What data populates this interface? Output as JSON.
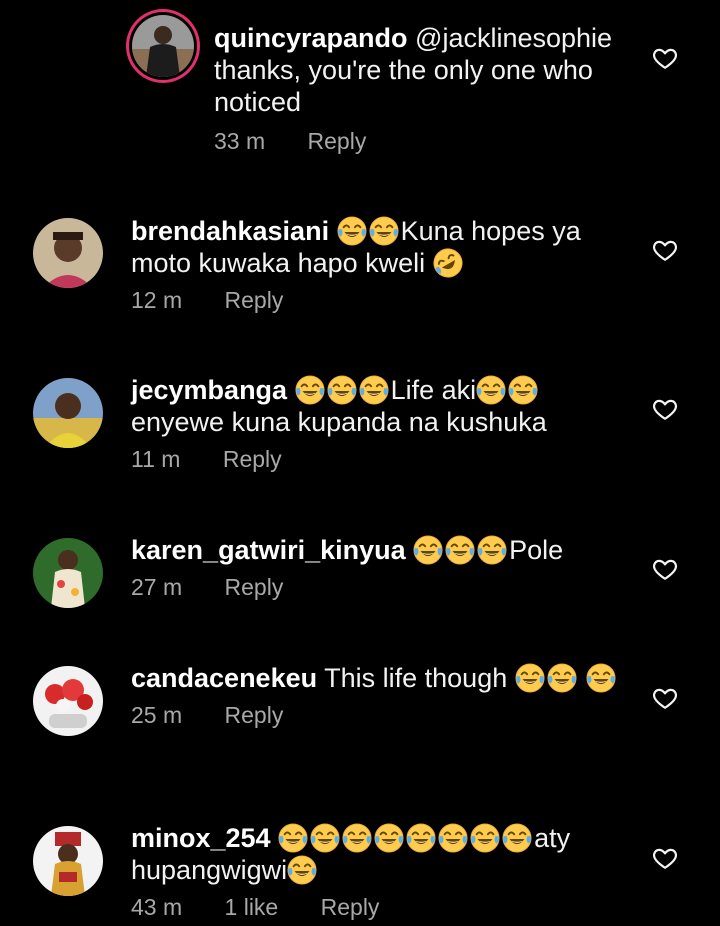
{
  "comments": [
    {
      "username": "quincyrapando",
      "text": "@jacklinesophie thanks, you're the only one who noticed",
      "time": "33 m",
      "reply": "Reply",
      "likes": ""
    },
    {
      "username": "brendahkasiani",
      "text_after_emoji": "Kuna hopes ya moto kuwaka hapo kweli",
      "time": "12 m",
      "reply": "Reply",
      "emoji": [
        "joy",
        "joy",
        "rofl"
      ]
    },
    {
      "username": "jecymbanga",
      "text_part1": "Life aki",
      "text_part2": "enyewe kuna kupanda na kushuka",
      "time": "11 m",
      "reply": "Reply",
      "emoji": [
        "joy",
        "joy",
        "joy",
        "joy",
        "joy"
      ]
    },
    {
      "username": "karen_gatwiri_kinyua",
      "text_after_emoji": "Pole",
      "time": "27 m",
      "reply": "Reply",
      "emoji": [
        "joy",
        "joy",
        "joy"
      ]
    },
    {
      "username": "candacenekeu",
      "text": "This life though",
      "time": "25 m",
      "reply": "Reply",
      "emoji": [
        "joy",
        "joy",
        "joy"
      ]
    },
    {
      "username": "minox_254",
      "text_part1": "aty",
      "text_part2": "hupangwigwi",
      "time": "43 m",
      "likes": "1 like",
      "reply": "Reply",
      "emoji": [
        "joy",
        "joy",
        "joy",
        "joy",
        "joy",
        "joy",
        "joy",
        "joy",
        "joy"
      ]
    }
  ],
  "icons": {
    "like": "heart-outline-icon"
  },
  "colors": {
    "background": "#000000",
    "meta": "#a8a8a8",
    "story_ring": "#e1306c"
  }
}
